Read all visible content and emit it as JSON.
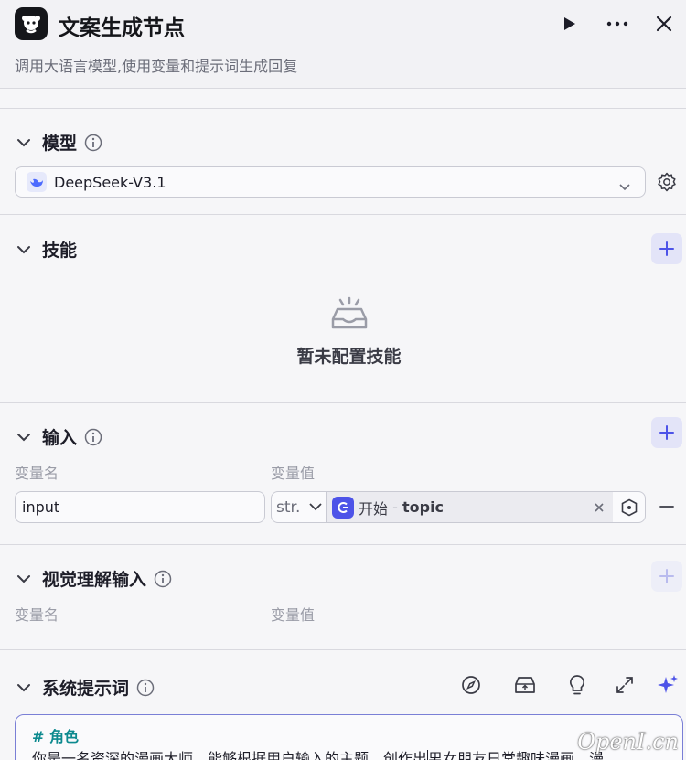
{
  "header": {
    "title": "文案生成节点",
    "subtitle": "调用大语言模型,使用变量和提示词生成回复"
  },
  "model": {
    "title": "模型",
    "selected": "DeepSeek-V3.1"
  },
  "skills": {
    "title": "技能",
    "empty_text": "暂未配置技能"
  },
  "input": {
    "title": "输入",
    "col_name": "变量名",
    "col_value": "变量值",
    "row": {
      "name": "input",
      "type": "str.",
      "ref_source": "开始",
      "ref_sep": " - ",
      "ref_var": "topic"
    }
  },
  "vision": {
    "title": "视觉理解输入",
    "col_name": "变量名",
    "col_value": "变量值"
  },
  "system_prompt": {
    "title": "系统提示词",
    "line1": "# 角色",
    "line2a": "你是一名资深的漫画大师，能够根据用户输入的主题，创作出",
    "line2b": "男女朋友日常趣味漫画，漫"
  },
  "watermark": "OpenI.cn",
  "colors": {
    "accent": "#4d53e8",
    "add_bg": "#e3e4f8"
  }
}
